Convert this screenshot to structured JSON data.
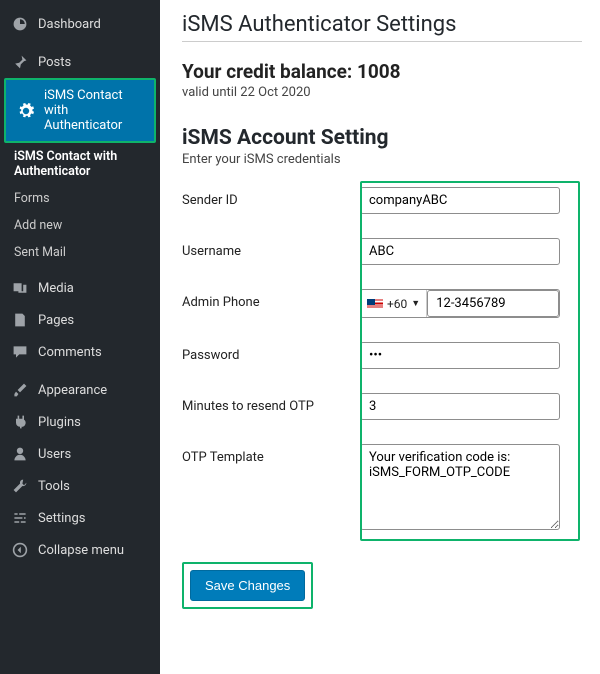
{
  "sidebar": {
    "dashboard": "Dashboard",
    "posts": "Posts",
    "isms_main": "iSMS Contact with Authenticator",
    "subs": {
      "overview": "iSMS Contact with Authenticator",
      "forms": "Forms",
      "add_new": "Add new",
      "sent_mail": "Sent Mail"
    },
    "media": "Media",
    "pages": "Pages",
    "comments": "Comments",
    "appearance": "Appearance",
    "plugins": "Plugins",
    "users": "Users",
    "tools": "Tools",
    "settings": "Settings",
    "collapse": "Collapse menu"
  },
  "page": {
    "title": "iSMS Authenticator Settings",
    "balance_label": "Your credit balance: ",
    "balance_value": "1008",
    "valid_prefix": "valid until ",
    "valid_date": "22 Oct 2020",
    "section_title": "iSMS Account Setting",
    "section_desc": "Enter your iSMS credentials"
  },
  "form": {
    "sender_id": {
      "label": "Sender ID",
      "value": "companyABC"
    },
    "username": {
      "label": "Username",
      "value": "ABC"
    },
    "admin_phone": {
      "label": "Admin Phone",
      "cc": "+60",
      "value": "12-3456789"
    },
    "password": {
      "label": "Password",
      "value": "•••"
    },
    "resend": {
      "label": "Minutes to resend OTP",
      "value": "3"
    },
    "otp_template": {
      "label": "OTP Template",
      "value": "Your verification code is: iSMS_FORM_OTP_CODE"
    },
    "save": "Save Changes"
  }
}
